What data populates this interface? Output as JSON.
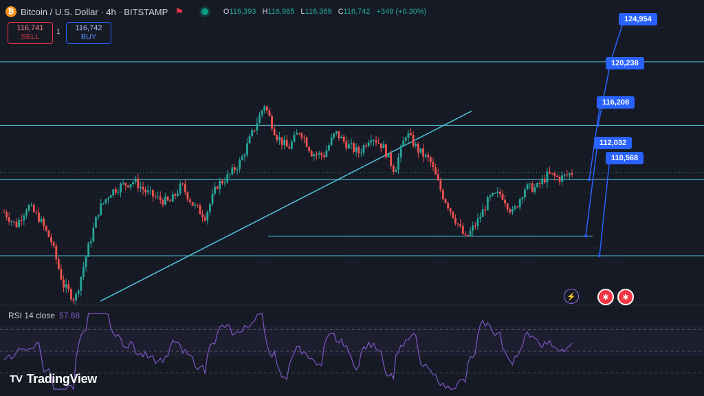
{
  "header": {
    "coin_glyph": "₿",
    "title": "Bitcoin / U.S. Dollar · 4h · BITSTAMP",
    "flag_icon": "flag-icon",
    "status_icon": "market-open-icon",
    "o_label": "O",
    "o_value": "116,393",
    "h_label": "H",
    "h_value": "116,985",
    "l_label": "L",
    "l_value": "116,369",
    "c_label": "C",
    "c_value": "116,742",
    "change": "+349 (+0.30%)"
  },
  "trade": {
    "sell_price": "116,741",
    "sell_label": "SELL",
    "spread": "1",
    "buy_price": "116,742",
    "buy_label": "BUY"
  },
  "price_labels": [
    "124,954",
    "120,238",
    "116,208",
    "112,032",
    "110,568"
  ],
  "rsi": {
    "label": "RSI 14 close",
    "value": "57.68"
  },
  "logo": {
    "mark": "TV",
    "text": "TradingView"
  },
  "icons": [
    "lightning-icon",
    "us-flag-icon",
    "us-flag-icon"
  ],
  "colors": {
    "background": "#161a25",
    "up": "#26a69a",
    "down": "#ef5350",
    "levels": "#4fc3d7",
    "rsi": "#7e57c2",
    "label": "#2962ff"
  },
  "chart_data": {
    "type": "candlestick",
    "symbol": "Bitcoin / U.S. Dollar",
    "interval": "4h",
    "exchange": "BITSTAMP",
    "ylim": [
      107000,
      127500
    ],
    "horizontal_levels": [
      124954,
      120238,
      116208,
      112032,
      110568
    ],
    "trendline": {
      "from": [
        0,
        107200
      ],
      "to": [
        1,
        121300
      ]
    },
    "close_path": [
      113800,
      112800,
      114300,
      113300,
      111600,
      108400,
      107300,
      110800,
      114000,
      115300,
      115800,
      116100,
      115300,
      114800,
      114500,
      115800,
      114300,
      113500,
      115800,
      116500,
      117600,
      119700,
      121800,
      119500,
      118500,
      119900,
      118200,
      118000,
      119700,
      118800,
      118200,
      119500,
      118700,
      116900,
      119700,
      118400,
      117600,
      115200,
      113500,
      111800,
      113100,
      114800,
      115200,
      113700,
      115600,
      115600,
      116600,
      116300,
      116742
    ],
    "rsi": {
      "period": 14,
      "last": 57.68,
      "levels": [
        70,
        50,
        30
      ],
      "ylim": [
        10,
        90
      ]
    }
  }
}
